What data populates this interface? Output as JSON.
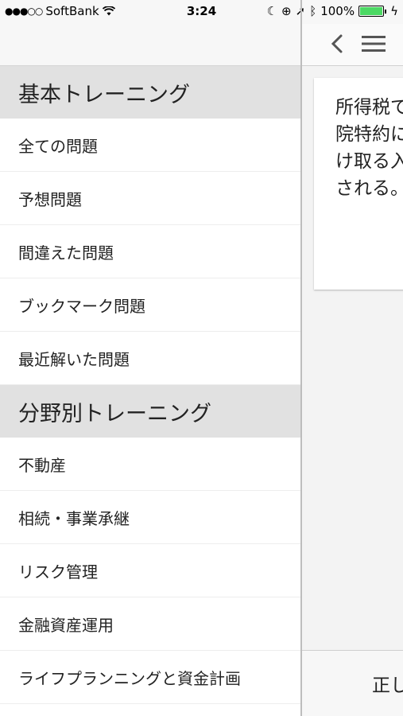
{
  "status_bar": {
    "carrier": "SoftBank",
    "time": "3:24",
    "battery": "100%",
    "signal_dots": "●●●○○"
  },
  "drawer": {
    "sections": [
      {
        "header": "基本トレーニング",
        "items": [
          "全ての問題",
          "予想問題",
          "間違えた問題",
          "ブックマーク問題",
          "最近解いた問題"
        ]
      },
      {
        "header": "分野別トレーニング",
        "items": [
          "不動産",
          "相続・事業承継",
          "リスク管理",
          "金融資産運用",
          "ライフプランニングと資金計画"
        ]
      }
    ]
  },
  "main": {
    "question_text": "所得税で\n院特約に\nけ取る入\nされる。",
    "bottom_label": "正し"
  }
}
